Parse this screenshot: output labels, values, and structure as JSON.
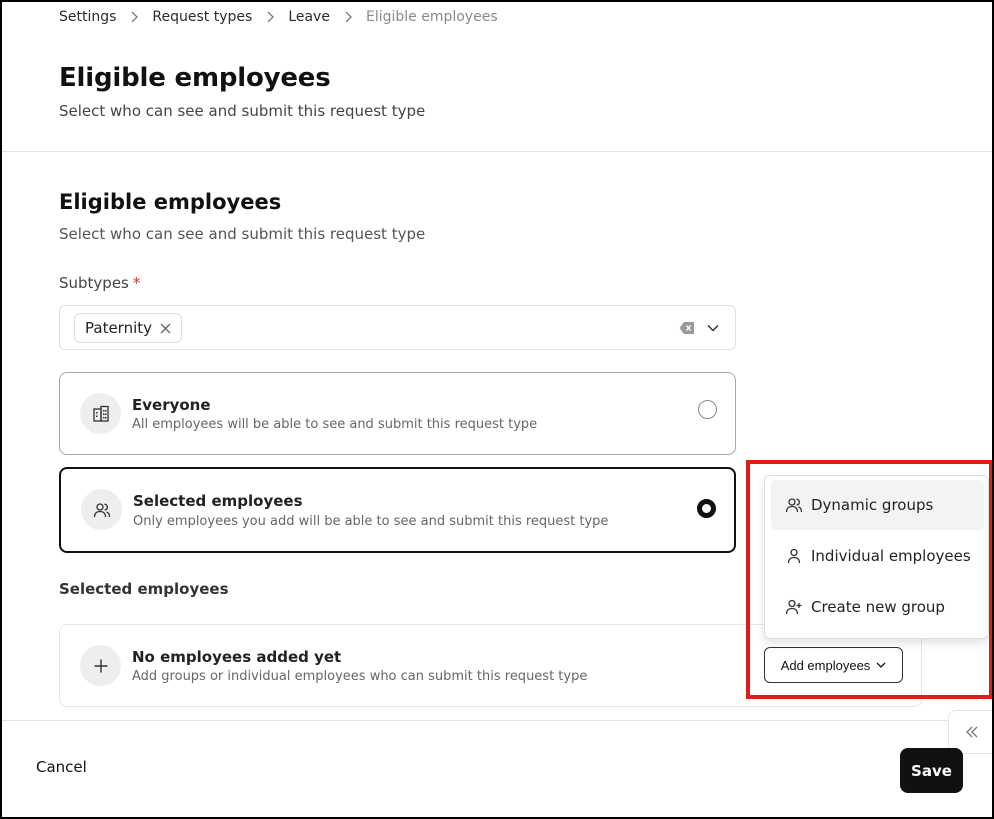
{
  "breadcrumb": {
    "items": [
      "Settings",
      "Request types",
      "Leave",
      "Eligible employees"
    ]
  },
  "header": {
    "title": "Eligible employees",
    "subtitle": "Select who can see and submit this request type"
  },
  "section": {
    "title": "Eligible employees",
    "subtitle": "Select who can see and submit this request type"
  },
  "subtypes": {
    "label": "Subtypes",
    "required_mark": "*",
    "selected_chip": "Paternity"
  },
  "options": {
    "everyone": {
      "title": "Everyone",
      "description": "All employees will be able to see and submit this request type",
      "icon": "building-icon",
      "selected": false
    },
    "selected": {
      "title": "Selected employees",
      "description": "Only employees you add will be able to see and submit this request type",
      "icon": "users-icon",
      "selected": true
    }
  },
  "selected_employees": {
    "label": "Selected employees",
    "empty_title": "No employees added yet",
    "empty_description": "Add groups or individual employees who can submit this request type",
    "add_button": "Add employees"
  },
  "dropdown": {
    "items": [
      {
        "label": "Dynamic groups",
        "icon": "users-icon"
      },
      {
        "label": "Individual employees",
        "icon": "user-icon"
      },
      {
        "label": "Create new group",
        "icon": "user-plus-icon"
      }
    ]
  },
  "footer": {
    "cancel_label": "Cancel",
    "save_label": "Save"
  },
  "colors": {
    "highlight": "#e11a1a",
    "primary": "#111111",
    "required": "#d9262c"
  }
}
